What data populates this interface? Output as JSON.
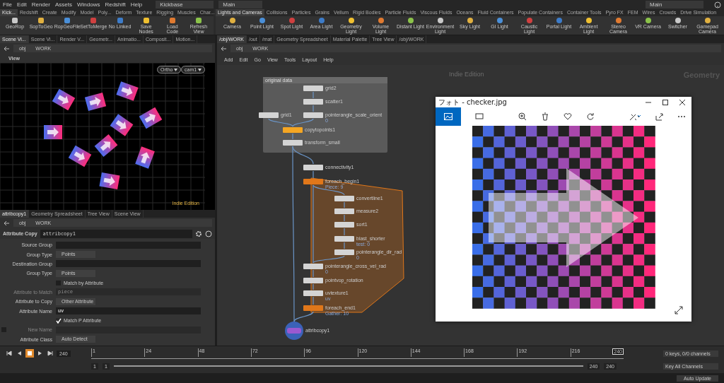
{
  "menu": [
    "File",
    "Edit",
    "Render",
    "Assets",
    "Windows",
    "Redshift",
    "Help"
  ],
  "desktop": "Kickbase",
  "context": "Main",
  "right_context": "Main",
  "left_shelf": {
    "tabs": [
      {
        "label": "Kick...",
        "selected": true
      },
      {
        "label": "Redshift",
        "selected": false
      },
      {
        "label": "Create",
        "selected": false
      },
      {
        "label": "Modify",
        "selected": false
      },
      {
        "label": "Model",
        "selected": false
      },
      {
        "label": "Poly...",
        "selected": false
      },
      {
        "label": "Deform",
        "selected": false
      },
      {
        "label": "Texture",
        "selected": false
      },
      {
        "label": "Rigging",
        "selected": false
      },
      {
        "label": "Muscles",
        "selected": false
      },
      {
        "label": "Char...",
        "selected": false
      }
    ],
    "tools": [
      "GeoRop",
      "SopToGeo",
      "RopGeoFile",
      "SetToMerge",
      "No Linked",
      "Save Nodes",
      "Load Code",
      "Refresh View"
    ]
  },
  "right_shelf": {
    "tabs": [
      {
        "label": "Lights and Cameras",
        "selected": true
      },
      {
        "label": "Collisions",
        "selected": false
      },
      {
        "label": "Particles",
        "selected": false
      },
      {
        "label": "Grains",
        "selected": false
      },
      {
        "label": "Vellum",
        "selected": false
      },
      {
        "label": "Rigid Bodies",
        "selected": false
      },
      {
        "label": "Particle Fluids",
        "selected": false
      },
      {
        "label": "Viscous Fluids",
        "selected": false
      },
      {
        "label": "Oceans",
        "selected": false
      },
      {
        "label": "Fluid Containers",
        "selected": false
      },
      {
        "label": "Populate Containers",
        "selected": false
      },
      {
        "label": "Container Tools",
        "selected": false
      },
      {
        "label": "Pyro FX",
        "selected": false
      },
      {
        "label": "FEM",
        "selected": false
      },
      {
        "label": "Wires",
        "selected": false
      },
      {
        "label": "Crowds",
        "selected": false
      },
      {
        "label": "Drive Simulation",
        "selected": false
      }
    ],
    "tools": [
      "Camera",
      "Point Light",
      "Spot Light",
      "Area Light",
      "Geometry Light",
      "Volume Light",
      "Distant Light",
      "Environment Light",
      "Sky Light",
      "GI Light",
      "Caustic Light",
      "Portal Light",
      "Ambient Light",
      "Stereo Camera",
      "VR Camera",
      "Switcher",
      "Gamepad Camera"
    ]
  },
  "viewer": {
    "tabs": [
      {
        "label": "Scene Vi...",
        "selected": true
      },
      {
        "label": "Scene Vi...",
        "selected": false
      },
      {
        "label": "Render V...",
        "selected": false
      },
      {
        "label": "Geometr...",
        "selected": false
      },
      {
        "label": "Animatio...",
        "selected": false
      },
      {
        "label": "Composit...",
        "selected": false
      },
      {
        "label": "Motion...",
        "selected": false
      }
    ],
    "path": [
      "obj",
      "WORK"
    ],
    "title": "View",
    "projection": "Ortho",
    "camera": "cam1",
    "edition": "Indie Edition"
  },
  "params": {
    "tabs": [
      {
        "label": "attribcopy1",
        "selected": true
      },
      {
        "label": "Geometry Spreadsheet",
        "selected": false
      },
      {
        "label": "Tree View",
        "selected": false
      },
      {
        "label": "Scene View",
        "selected": false
      }
    ],
    "path": [
      "obj",
      "WORK"
    ],
    "node_type": "Attribute Copy",
    "node_name": "attribcopy1",
    "rows": [
      {
        "kind": "field",
        "label": "Source Group",
        "disabled": false
      },
      {
        "kind": "menu",
        "label": "Group Type",
        "value": "Points"
      },
      {
        "kind": "field",
        "label": "Destination Group",
        "disabled": false
      },
      {
        "kind": "menu",
        "label": "Group Type",
        "value": "Points"
      },
      {
        "kind": "checkbox",
        "label": "Match by Attribute",
        "checked": false
      },
      {
        "kind": "field",
        "label": "Attribute to Match",
        "value": "piece",
        "disabled": true
      },
      {
        "kind": "menu",
        "label": "Attribute to Copy",
        "value": "Other Attribute"
      },
      {
        "kind": "field",
        "label": "Attribute Name",
        "value": "uv",
        "disabled": false
      },
      {
        "kind": "checkbox",
        "label": "Match P Attribute",
        "checked": true
      },
      {
        "kind": "field",
        "label": "New Name",
        "disabled": true,
        "toggle": false
      },
      {
        "kind": "menu",
        "label": "Attribute Class",
        "value": "Auto Detect"
      }
    ]
  },
  "network": {
    "tabs": [
      {
        "label": "/obj/WORK",
        "selected": true
      },
      {
        "label": "/out",
        "selected": false
      },
      {
        "label": "/mat",
        "selected": false
      },
      {
        "label": "Geometry Spreadsheet",
        "selected": false
      },
      {
        "label": "Material Palette",
        "selected": false
      },
      {
        "label": "Tree View",
        "selected": false
      },
      {
        "label": "/obj/WORK",
        "selected": false
      }
    ],
    "path": [
      "obj",
      "WORK"
    ],
    "menu": [
      "Add",
      "Edit",
      "Go",
      "View",
      "Tools",
      "Layout",
      "Help"
    ],
    "edition": "Indie Edition",
    "context": "Geometry",
    "box_title": "original data",
    "nodes": [
      {
        "kind": "box",
        "name": "grid2",
        "color": "#d4d4d4"
      },
      {
        "kind": "box",
        "name": "scatter1",
        "color": "#d4d4d4"
      },
      {
        "kind": "box",
        "name": "grid1",
        "color": "#d4d4d4"
      },
      {
        "kind": "box",
        "name": "pointerangle_scale_orient",
        "info": "0",
        "color": "#d4d4d4"
      },
      {
        "kind": "box",
        "name": "copytopoints1",
        "color": "#f5a623"
      },
      {
        "kind": "box",
        "name": "transform_small",
        "color": "#d4d4d4"
      },
      {
        "kind": "box",
        "name": "connectivity1",
        "color": "#d4d4d4"
      },
      {
        "kind": "box",
        "name": "foreach_begin1",
        "info": "Piece: 9",
        "color": "#e0771a"
      },
      {
        "kind": "box",
        "name": "convertline1",
        "color": "#d4d4d4"
      },
      {
        "kind": "box",
        "name": "measure2",
        "color": "#d4d4d4"
      },
      {
        "kind": "box",
        "name": "sort1",
        "color": "#d4d4d4"
      },
      {
        "kind": "box",
        "name": "blast_shorter",
        "info": "test: 0",
        "color": "#d4d4d4"
      },
      {
        "kind": "box",
        "name": "pointerangle_dir_rad",
        "info": "0",
        "color": "#d4d4d4"
      },
      {
        "kind": "box",
        "name": "pointerangle_cross_vel_rad",
        "info": "0",
        "color": "#d4d4d4"
      },
      {
        "kind": "box",
        "name": "pointvop_rotation",
        "color": "#d4d4d4"
      },
      {
        "kind": "box",
        "name": "uvtexture1",
        "info": "uv",
        "color": "#d4d4d4"
      },
      {
        "kind": "box",
        "name": "foreach_end1",
        "info": "Gather: 10",
        "color": "#e0771a"
      },
      {
        "kind": "display",
        "name": "attribcopy1",
        "color": "#9b59d0"
      }
    ]
  },
  "photo_viewer": {
    "title": "フォト - checker.jpg"
  },
  "timeline": {
    "frame": "240",
    "ticks": [
      "1",
      "24",
      "48",
      "72",
      "96",
      "120",
      "144",
      "168",
      "192",
      "216"
    ],
    "marker": "240",
    "start": "1",
    "range_start": "1",
    "range_end": "240",
    "end": "240",
    "keys": "0 keys, 0/0 channels",
    "key_button": "Key All Channels"
  },
  "status": {
    "update_mode": "Auto Update"
  }
}
